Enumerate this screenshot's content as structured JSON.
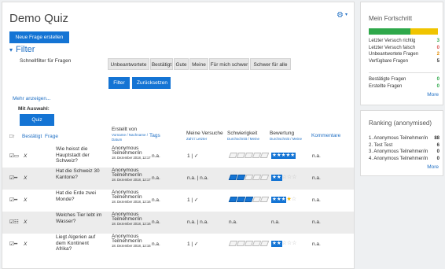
{
  "quiz": {
    "title": "Demo Quiz",
    "new_question_label": "Neue Frage erstellen",
    "filter_heading": "Filter",
    "quick_filter_label": "Schnellfilter für Fragen",
    "quick_filters": [
      "Unbeantwortete",
      "Bestätigt",
      "Gute",
      "Meine",
      "Für mich schwer",
      "Schwer für alle"
    ],
    "filter_button": "Filter",
    "reset_button": "Zurücksetzen",
    "more_link": "Mehr anzeigen...",
    "selection_label": "Mit Auswahl:",
    "start_quiz_button": "Quiz starten"
  },
  "table": {
    "headers": {
      "confirmed": "Bestätigt",
      "question": "Frage",
      "created_by": "Erstellt von",
      "created_by_sub": "Vorname / Nachname / Datum",
      "tags": "Tags",
      "my_attempts": "Meine Versuche",
      "my_attempts_sub": "Zahl / Letzter",
      "difficulty": "Schwierigkeit",
      "difficulty_sub": "Durchschnitt / Meine",
      "rating": "Bewertung",
      "rating_sub": "Durchschnitt / Meine",
      "comments": "Kommentare"
    },
    "rows": [
      {
        "type_icon": "☑▭",
        "confirmed": "X",
        "question": "Wie heisst die Hauptstadt der Schweiz?",
        "author": "Anonymous Teilnehmer/in",
        "date": "18. Dezember 2018, 12:17",
        "tags": "n.a.",
        "attempts": "1 | ✓",
        "difficulty_level": 0,
        "rating_full": 5,
        "rating_half": false,
        "rating_text": "★★★★★",
        "rating_rest": "",
        "comments": "n.a."
      },
      {
        "type_icon": "☑•• ",
        "confirmed": "X",
        "question": "Hat die Schweiz 30 Kantone?",
        "author": "Anonymous Teilnehmer/in",
        "date": "18. Dezember 2018, 12:17",
        "tags": "n.a.",
        "attempts": "n.a. | n.a.",
        "difficulty_level": 2,
        "rating_full": 2,
        "rating_half": false,
        "rating_text": "★★",
        "rating_rest": "☆☆☆",
        "comments": "n.a."
      },
      {
        "type_icon": "☑•• ",
        "confirmed": "X",
        "question": "Hat die Erde zwei Monde?",
        "author": "Anonymous Teilnehmer/in",
        "date": "18. Dezember 2018, 12:16",
        "tags": "n.a.",
        "attempts": "1 | ✓",
        "difficulty_level": 3,
        "rating_full": 3,
        "rating_half": true,
        "rating_text": "★★★",
        "rating_rest": "☆",
        "comments": "n.a."
      },
      {
        "type_icon": "☑☷",
        "confirmed": "X",
        "question": "Welches Tier lebt im Wasser?",
        "author": "Anonymous Teilnehmer/in",
        "date": "18. Dezember 2018, 12:16",
        "tags": "n.a.",
        "attempts": "n.a. | n.a.",
        "difficulty_text": "n.a.",
        "rating_text_plain": "n.a.",
        "comments": "n.a."
      },
      {
        "type_icon": "☑•• ",
        "confirmed": "X",
        "question": "Liegt Algerien auf dem Kontinent Afrika?",
        "author": "Anonymous Teilnehmer/in",
        "date": "18. Dezember 2018, 12:15",
        "tags": "n.a.",
        "attempts": "1 | ✓",
        "difficulty_level": 0,
        "rating_full": 2,
        "rating_half": false,
        "rating_text": "★★",
        "rating_rest": "☆☆☆",
        "comments": "n.a."
      }
    ]
  },
  "progress": {
    "title": "Mein Fortschritt",
    "bar_correct_fraction": 0.6,
    "stats": [
      {
        "label": "Letzter Versuch richtig",
        "value": "3",
        "color": "#2ea84a"
      },
      {
        "label": "Letzter Versuch falsch",
        "value": "0",
        "color": "#d9534f"
      },
      {
        "label": "Unbeantwortete Fragen",
        "value": "2",
        "color": "#e08a00"
      },
      {
        "label": "Verfügbare Fragen",
        "value": "5",
        "color": "#333333"
      }
    ],
    "stats2": [
      {
        "label": "Bestätigte Fragen",
        "value": "0",
        "color": "#2ea84a"
      },
      {
        "label": "Erstellte Fragen",
        "value": "0",
        "color": "#2ea84a"
      }
    ],
    "more": "More"
  },
  "ranking": {
    "title": "Ranking (anonymised)",
    "entries": [
      {
        "label": "1. Anonymous Teilnehmer/in",
        "value": "88"
      },
      {
        "label": "2. Test Test",
        "value": "6"
      },
      {
        "label": "3. Anonymous Teilnehmer/in",
        "value": "0"
      },
      {
        "label": "4. Anonymous Teilnehmer/in",
        "value": "0"
      }
    ],
    "more": "More"
  },
  "colors": {
    "accent": "#1474d4",
    "correct": "#2ea84a",
    "unanswered": "#f0c400"
  }
}
